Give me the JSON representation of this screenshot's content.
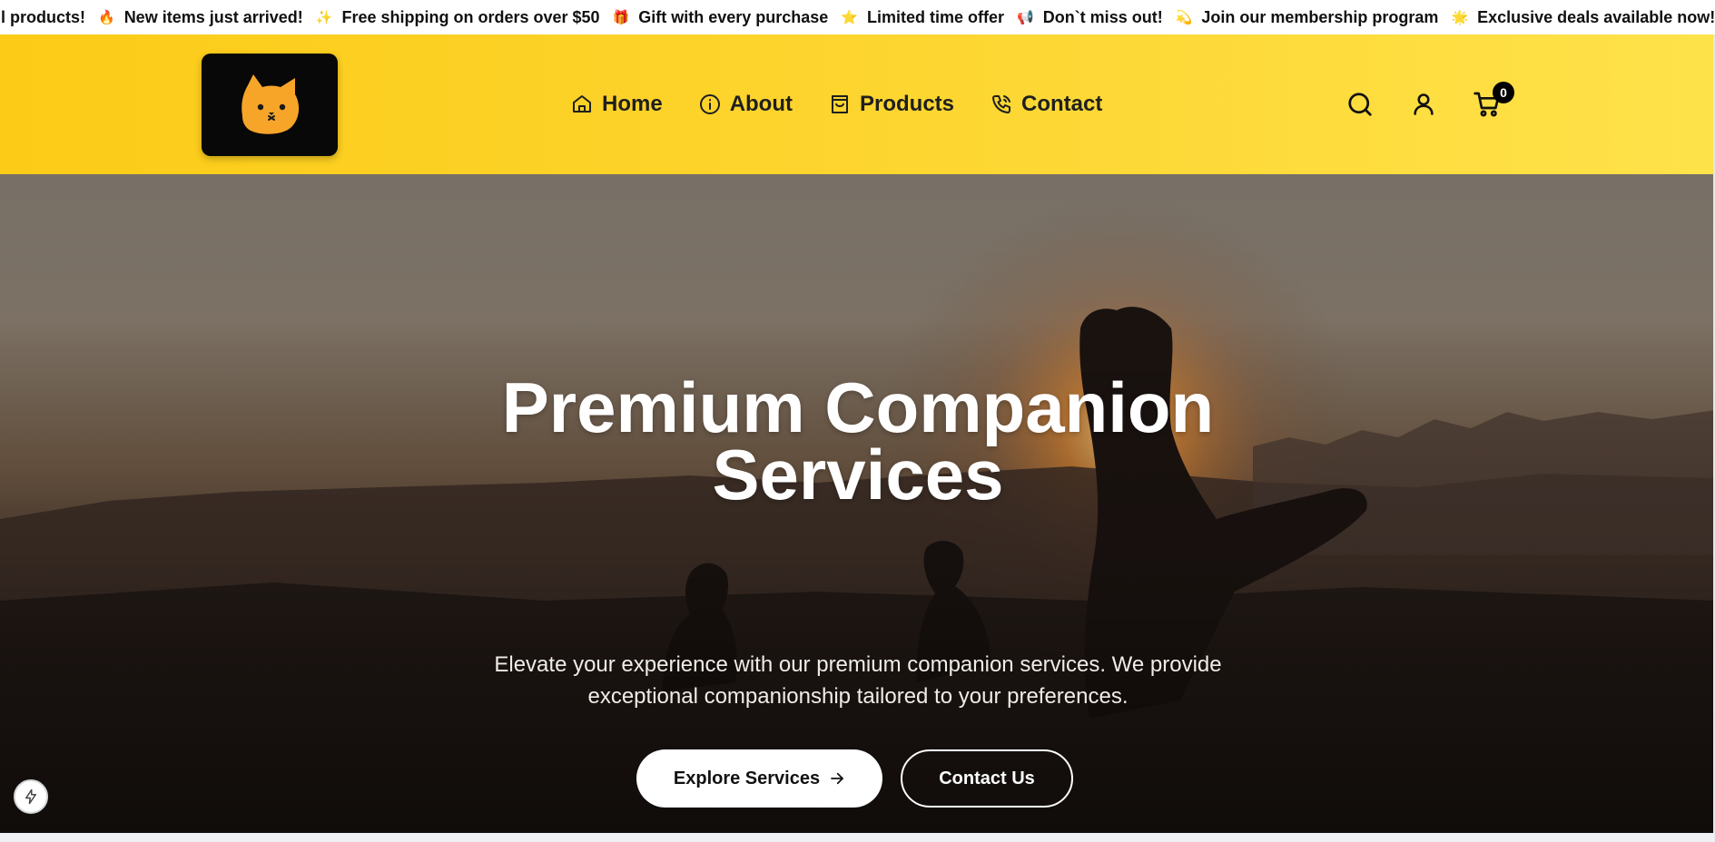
{
  "ticker": {
    "items": [
      {
        "emoji": "",
        "text": "ll products!"
      },
      {
        "emoji": "🔥",
        "text": "New items just arrived!"
      },
      {
        "emoji": "✨",
        "text": "Free shipping on orders over $50"
      },
      {
        "emoji": "🎁",
        "text": "Gift with every purchase"
      },
      {
        "emoji": "⭐",
        "text": "Limited time offer"
      },
      {
        "emoji": "📢",
        "text": "Don`t miss out!"
      },
      {
        "emoji": "💫",
        "text": "Join our membership program"
      },
      {
        "emoji": "🌟",
        "text": "Exclusive deals available now!"
      }
    ]
  },
  "header": {
    "logo_icon": "cat-face-icon",
    "nav": [
      {
        "label": "Home",
        "icon": "home-icon"
      },
      {
        "label": "About",
        "icon": "info-icon"
      },
      {
        "label": "Products",
        "icon": "shopping-bag-icon"
      },
      {
        "label": "Contact",
        "icon": "phone-icon"
      }
    ],
    "actions": {
      "search_icon": "search-icon",
      "account_icon": "user-icon",
      "cart_icon": "cart-icon",
      "cart_count": "0"
    }
  },
  "hero": {
    "title_line1": "Premium Companion",
    "title_line2": "Services",
    "subtitle_line1": "Elevate your experience with our premium companion services. We provide",
    "subtitle_line2": "exceptional companionship tailored to your preferences.",
    "primary_button": "Explore Services",
    "secondary_button": "Contact Us"
  },
  "colors": {
    "header_yellow": "#fdd631",
    "logo_bg": "#080808",
    "cat_orange": "#f7a529",
    "text_dark": "#1f1f1f"
  }
}
